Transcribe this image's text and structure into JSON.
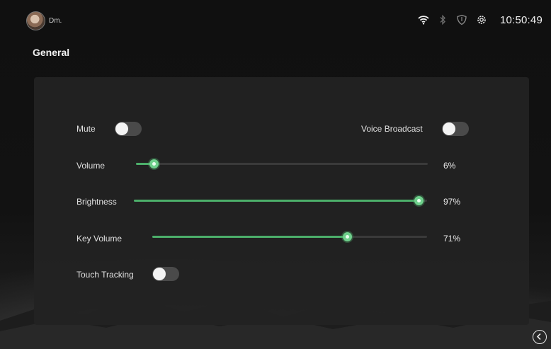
{
  "status": {
    "username": "Dm.",
    "time": "10:50:49",
    "icons": [
      "wifi-icon",
      "bluetooth-icon",
      "shield-icon",
      "settings-gear-icon"
    ]
  },
  "page": {
    "title": "General"
  },
  "settings": {
    "mute": {
      "label": "Mute",
      "on": false
    },
    "voice_broadcast": {
      "label": "Voice Broadcast",
      "on": false
    },
    "volume": {
      "label": "Volume",
      "value": 6,
      "value_text": "6%"
    },
    "brightness": {
      "label": "Brightness",
      "value": 97,
      "value_text": "97%"
    },
    "key_volume": {
      "label": "Key Volume",
      "value": 71,
      "value_text": "71%"
    },
    "touch_tracking": {
      "label": "Touch Tracking",
      "on": false
    }
  },
  "colors": {
    "accent": "#4caf6a",
    "thumb": "#6fd08c",
    "card": "#222222",
    "toggle_off": "#4a4a4a"
  }
}
